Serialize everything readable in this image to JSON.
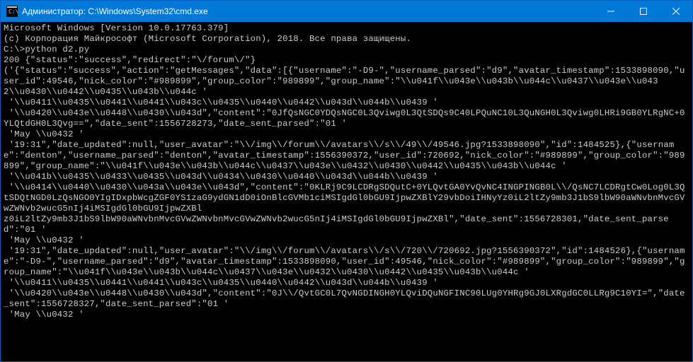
{
  "titlebar": {
    "title": "Администратор: C:\\Windows\\System32\\cmd.exe"
  },
  "terminal": {
    "lines": [
      "Microsoft Windows [Version 10.0.17763.379]",
      "(c) Корпорация Майкрософт (Microsoft Corporation), 2018. Все права защищены.",
      "",
      "C:\\>python d2.py",
      "200 {\"status\":\"success\",\"redirect\":\"\\/forum\\/\"}",
      "('{\"status\":\"success\",\"action\":\"getMessages\",\"data\":[{\"username\":\"-D9-\",\"username_parsed\":\"d9\",\"avatar_timestamp\":1533898090,\"user_id\":49546,\"nick_color\":\"#989899\",\"group_color\":\"989899\",\"group_name\":\"\\\\u041f\\\\u043e\\\\u043b\\\\u044c\\\\u0437\\\\u043e\\\\u043",
      "2\\\\u0430\\\\u0442\\\\u0435\\\\u043b\\\\u044c '",
      " '\\\\u0411\\\\u0435\\\\u0441\\\\u0441\\\\u043c\\\\u0435\\\\u0440\\\\u0442\\\\u043d\\\\u044b\\\\u0439 '",
      " '\\\\u0420\\\\u043e\\\\u0448\\\\u0430\\\\u043d\",\"content\":\"0JfQsNGC0YDQsNGC0L3Qviwg0L3QtSDQs9C40LPQuNC10L3QuNGH0L3Qviwg0LHRi9GB0YLRgNC+0YLQtdGH0L3Qvg==\",\"date_sent\":1556728273,\"date_sent_parsed\":\"01 '",
      " 'May \\\\u0432 '",
      " '19:31\",\"date_updated\":null,\"user_avatar\":\"\\\\/img\\\\/forum\\\\/avatars\\\\/s\\\\/49\\\\/49546.jpg?1533898090\",\"id\":1484525},{\"username\":\"denton\",\"username_parsed\":\"denton\",\"avatar_timestamp\":1556390372,\"user_id\":720692,\"nick_color\":\"#989899\",\"group_color\":\"989899\",\"group_name\":\"\\\\u041f\\\\u043e\\\\u043b\\\\u044c\\\\u0437\\\\u043e\\\\u0432\\\\u0430\\\\u0442\\\\u0435\\\\u043b\\\\u044c '",
      " '\\\\u041b\\\\u0435\\\\u0433\\\\u0435\\\\u043d\\\\u0434\\\\u0430\\\\u0440\\\\u043d\\\\u044b\\\\u0439 '",
      " '\\\\u0414\\\\u0440\\\\u0430\\\\u043a\\\\u043e\\\\u043d\",\"content\":\"0KLRj9C9LCDRgSDQutC+0YLQvtGA0YvQvNC4INGPINGB0L\\\\/QsNC7LCDRgtCw0Log0L3QtSDQtNGD0LzQsNGO0YIgIDxpbWcgZGF0YS1zaG9ydGN1dD0iOnBlcGVMb1ciMSIgdGl0bGU9IjpwZXBlY29vbDoiIHNyYz0iL2ltZy9mb3J1bS9lbW90aWNvbnMvcGVwZWNvb2wucG5nIj4iMSIgdGl0bGU9IjpwZXBl",
      "z0iL2ltZy9mb3J1bS9lbW90aWNvbnMvcGVwZWNvbnMvcGVwZWNvb2wucG5nIj4iMSIgdGl0bGU9IjpwZXBl\",\"date_sent\":1556728301,\"date_sent_parsed\":\"01 '",
      " 'May \\\\u0432 '",
      " '19:31\",\"date_updated\":null,\"user_avatar\":\"\\\\/img\\\\/forum\\\\/avatars\\\\/s\\\\/720\\\\/720692.jpg?1556390372\",\"id\":1484526},{\"username\":\"-D9-\",\"username_parsed\":\"d9\",\"avatar_timestamp\":1533898090,\"user_id\":49546,\"nick_color\":\"#989899\",\"group_color\":\"989899\",\"group_name\":\"\\\\u041f\\\\u043e\\\\u043b\\\\u044c\\\\u0437\\\\u043e\\\\u0432\\\\u0430\\\\u0442\\\\u0435\\\\u043b\\\\u044c '",
      " '\\\\u0411\\\\u0435\\\\u0441\\\\u0441\\\\u043c\\\\u0435\\\\u0440\\\\u0442\\\\u043d\\\\u044b\\\\u0439 '",
      " '\\\\u0420\\\\u043e\\\\u0448\\\\u0430\\\\u043d\",\"content\":\"0J\\\\/QvtGC0L7QvNGDINGH0YLQviDQuNGFINC90LUg0YHRg9GJ0LXRgdGC0LLRg9C10YI=\",\"date_sent\":1556728327,\"date_sent_parsed\":\"01 '",
      " 'May \\\\u0432 '"
    ]
  }
}
